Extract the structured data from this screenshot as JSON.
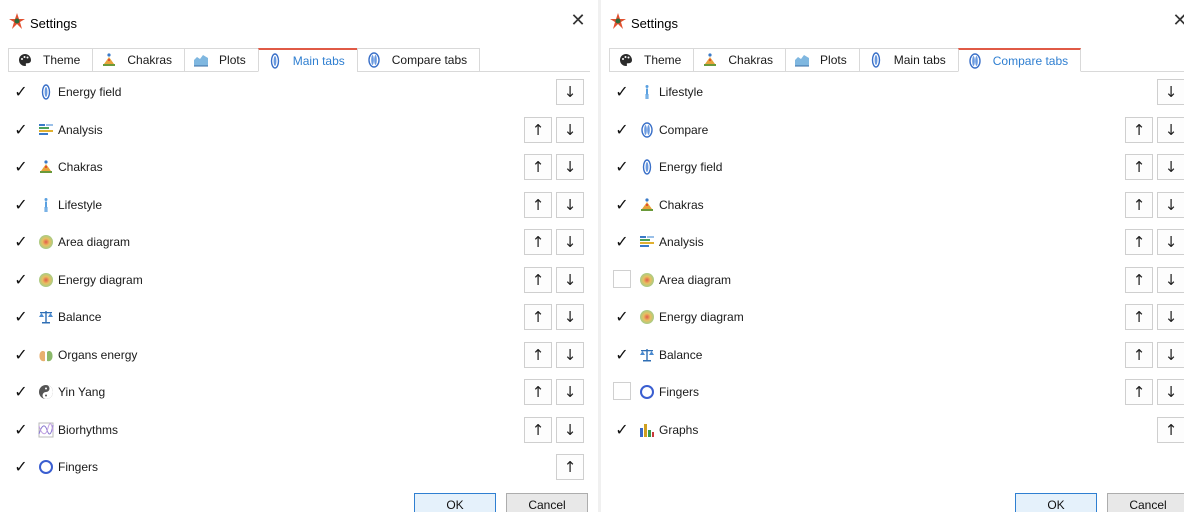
{
  "left_window": {
    "title": "Settings",
    "close_glyph": "✕",
    "tabs": [
      {
        "label": "Theme",
        "icon": "palette-icon",
        "active": false
      },
      {
        "label": "Chakras",
        "icon": "chakra-figure-icon",
        "active": false
      },
      {
        "label": "Plots",
        "icon": "plot-icon",
        "active": false
      },
      {
        "label": "Main tabs",
        "icon": "energy-field-icon",
        "active": true
      },
      {
        "label": "Compare tabs",
        "icon": "compare-icon",
        "active": false
      }
    ],
    "rows": [
      {
        "label": "Energy field",
        "checked": true,
        "icon": "energy-field-icon",
        "buttons": "down"
      },
      {
        "label": "Analysis",
        "checked": true,
        "icon": "analysis-icon",
        "buttons": "both"
      },
      {
        "label": "Chakras",
        "checked": true,
        "icon": "chakra-figure-icon",
        "buttons": "both"
      },
      {
        "label": "Lifestyle",
        "checked": true,
        "icon": "lifestyle-figure-icon",
        "buttons": "both"
      },
      {
        "label": "Area diagram",
        "checked": true,
        "icon": "aura-circle-icon",
        "buttons": "both"
      },
      {
        "label": "Energy diagram",
        "checked": true,
        "icon": "aura-circle-icon",
        "buttons": "both"
      },
      {
        "label": "Balance",
        "checked": true,
        "icon": "balance-icon",
        "buttons": "both"
      },
      {
        "label": "Organs energy",
        "checked": true,
        "icon": "lungs-icon",
        "buttons": "both"
      },
      {
        "label": "Yin Yang",
        "checked": true,
        "icon": "yin-yang-icon",
        "buttons": "both"
      },
      {
        "label": "Biorhythms",
        "checked": true,
        "icon": "biorhythm-icon",
        "buttons": "both"
      },
      {
        "label": "Fingers",
        "checked": true,
        "icon": "ring-icon",
        "buttons": "up"
      }
    ],
    "ok_label": "OK",
    "cancel_label": "Cancel"
  },
  "right_window": {
    "title": "Settings",
    "close_glyph": "✕",
    "tabs": [
      {
        "label": "Theme",
        "icon": "palette-icon",
        "active": false
      },
      {
        "label": "Chakras",
        "icon": "chakra-figure-icon",
        "active": false
      },
      {
        "label": "Plots",
        "icon": "plot-icon",
        "active": false
      },
      {
        "label": "Main tabs",
        "icon": "energy-field-icon",
        "active": false
      },
      {
        "label": "Compare tabs",
        "icon": "compare-icon",
        "active": true
      }
    ],
    "rows": [
      {
        "label": "Lifestyle",
        "checked": true,
        "icon": "lifestyle-figure-icon",
        "buttons": "down"
      },
      {
        "label": "Compare",
        "checked": true,
        "icon": "compare-icon",
        "buttons": "both"
      },
      {
        "label": "Energy field",
        "checked": true,
        "icon": "energy-field-icon",
        "buttons": "both"
      },
      {
        "label": "Chakras",
        "checked": true,
        "icon": "chakra-figure-icon",
        "buttons": "both"
      },
      {
        "label": "Analysis",
        "checked": true,
        "icon": "analysis-icon",
        "buttons": "both"
      },
      {
        "label": "Area diagram",
        "checked": false,
        "icon": "aura-circle-icon",
        "buttons": "both"
      },
      {
        "label": "Energy diagram",
        "checked": true,
        "icon": "aura-circle-icon",
        "buttons": "both"
      },
      {
        "label": "Balance",
        "checked": true,
        "icon": "balance-icon",
        "buttons": "both"
      },
      {
        "label": "Fingers",
        "checked": false,
        "icon": "ring-icon",
        "buttons": "both"
      },
      {
        "label": "Graphs",
        "checked": true,
        "icon": "bar-graph-icon",
        "buttons": "up"
      }
    ],
    "ok_label": "OK",
    "cancel_label": "Cancel"
  },
  "glyphs": {
    "check": "✓",
    "up": "↑",
    "down": "↓"
  },
  "colors": {
    "accent": "#2f7fd1",
    "active_tab_top": "#e05a46",
    "border": "#d9d9d9"
  }
}
